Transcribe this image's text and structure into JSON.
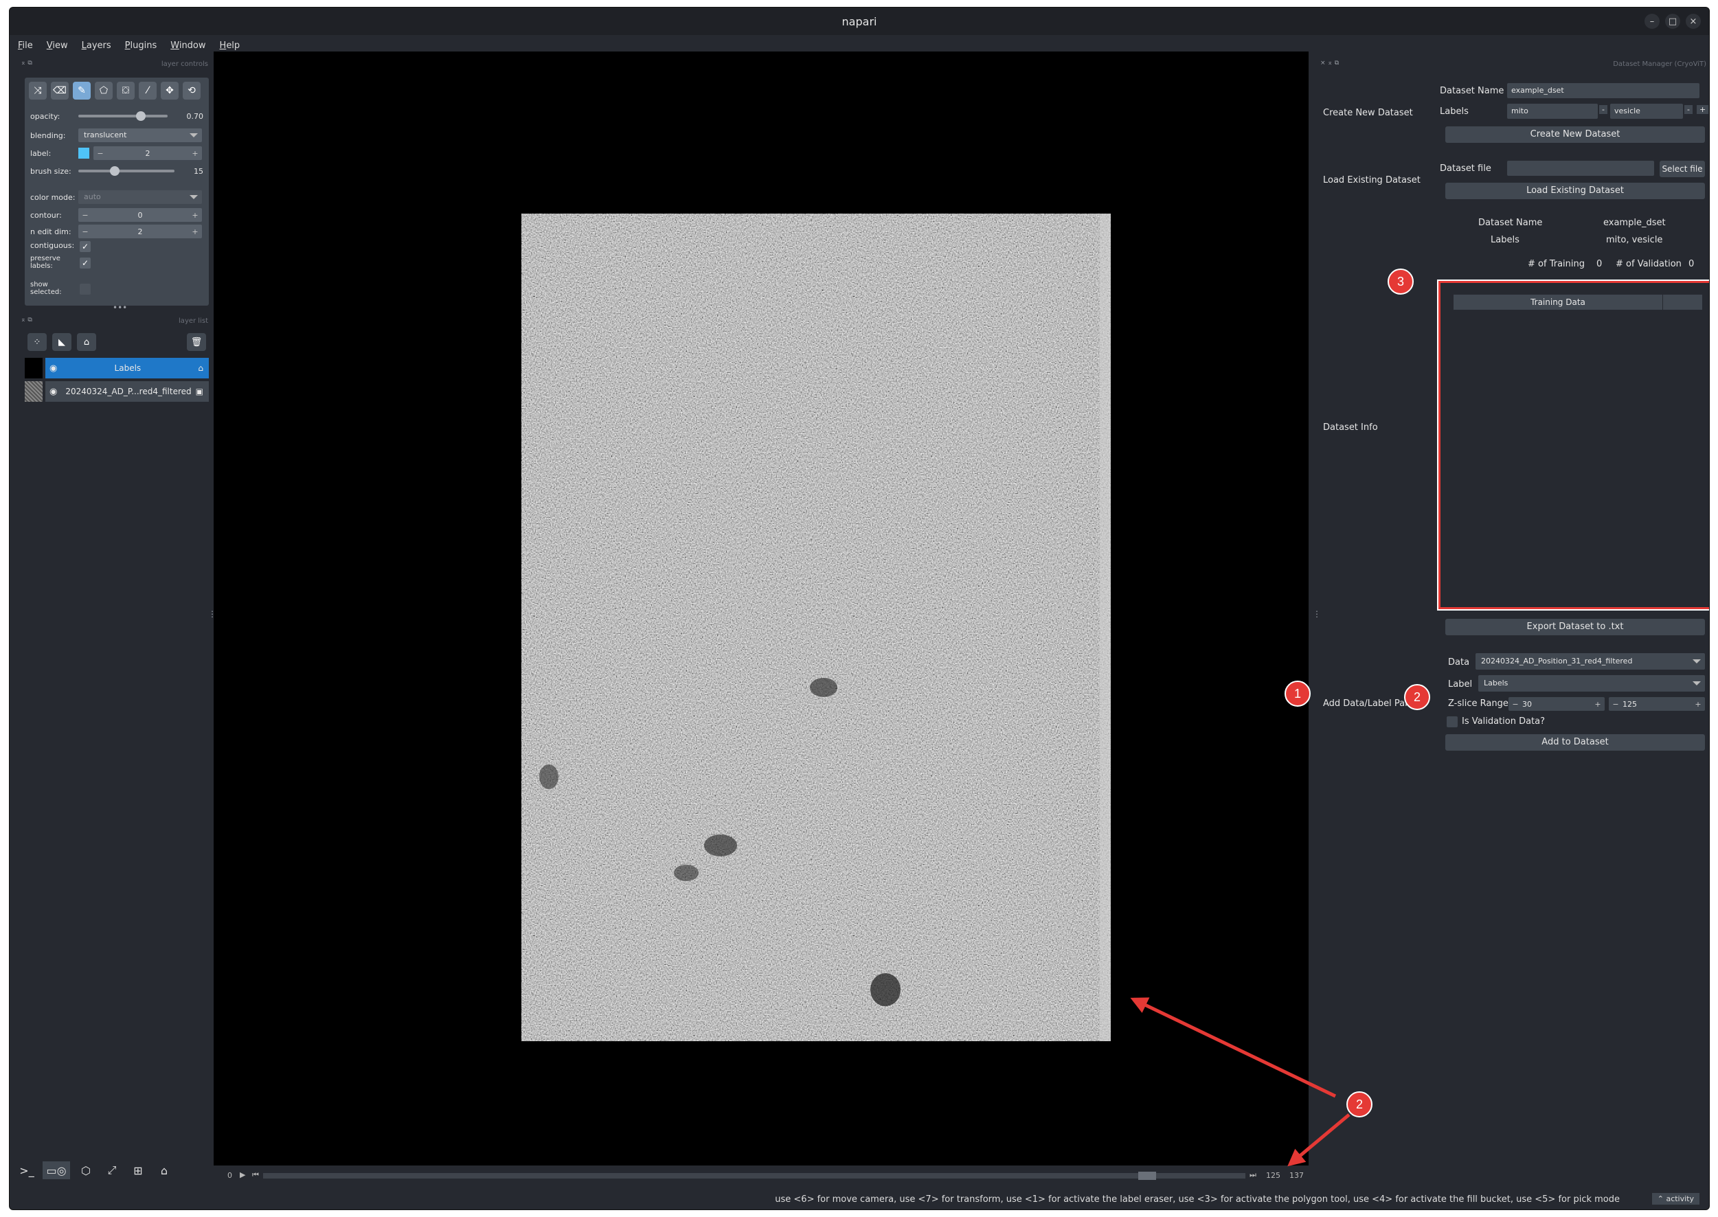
{
  "window": {
    "title": "napari",
    "controls": [
      "–",
      "□",
      "×"
    ]
  },
  "menu": [
    "File",
    "View",
    "Layers",
    "Plugins",
    "Window",
    "Help"
  ],
  "layer_controls": {
    "header": "layer controls",
    "tools": [
      "shuffle-icon",
      "eraser-icon",
      "paintbrush-icon",
      "polygon-icon",
      "fill-bucket-icon",
      "picker-icon",
      "move-icon",
      "transform-icon"
    ],
    "opacity_label": "opacity:",
    "opacity_value": "0.70",
    "opacity_frac": 0.7,
    "blending_label": "blending:",
    "blending_value": "translucent",
    "label_label": "label:",
    "label_value": "2",
    "label_color": "#4fc3f7",
    "brush_label": "brush size:",
    "brush_value": "15",
    "brush_frac": 0.38,
    "colormode_label": "color mode:",
    "colormode_value": "auto",
    "contour_label": "contour:",
    "contour_value": "0",
    "nedit_label": "n edit dim:",
    "nedit_value": "2",
    "contiguous_label": "contiguous:",
    "preserve_label_1": "preserve",
    "preserve_label_2": "labels:",
    "show_label_1": "show",
    "show_label_2": "selected:"
  },
  "layer_list": {
    "header": "layer list",
    "layers": [
      {
        "name": "Labels",
        "selected": true
      },
      {
        "name": "20240324_AD_P...red4_filtered",
        "selected": false
      }
    ]
  },
  "dims": {
    "start": "0",
    "current": "125",
    "max": "137",
    "frac": 0.9
  },
  "status_text": "use <6> for move camera, use <7> for transform, use <1> for activate the label eraser, use <3> for activate the polygon tool, use <4> for activate the fill bucket, use <5> for pick mode",
  "activity": "activity",
  "dataset_manager": {
    "header": "Dataset Manager (CryoViT)",
    "create_section": "Create New Dataset",
    "dataset_name_label": "Dataset Name",
    "dataset_name_value": "example_dset",
    "labels_label": "Labels",
    "label_1": "mito",
    "label_2": "vesicle",
    "create_button": "Create New Dataset",
    "load_section": "Load Existing Dataset",
    "dataset_file_label": "Dataset file",
    "select_file_button": "Select file",
    "load_button": "Load Existing Dataset",
    "info_name_label": "Dataset Name",
    "info_name_value": "example_dset",
    "info_labels_label": "Labels",
    "info_labels_value": "mito, vesicle",
    "training_count_label": "# of Training",
    "training_count": "0",
    "validation_count_label": "# of Validation",
    "validation_count": "0",
    "info_section": "Dataset Info",
    "table_header": "Training Data",
    "export_button": "Export Dataset to .txt",
    "add_section": "Add Data/Label Pair",
    "data_label": "Data",
    "data_value": "20240324_AD_Position_31_red4_filtered",
    "label_label": "Label",
    "label_value": "Labels",
    "zslice_label": "Z-slice Range",
    "zslice_min": "30",
    "zslice_max": "125",
    "validation_check_label": "Is Validation Data?",
    "add_button": "Add to Dataset"
  },
  "annotations": {
    "badge_1": "1",
    "badge_2a": "2",
    "badge_2b": "2",
    "badge_3": "3"
  }
}
